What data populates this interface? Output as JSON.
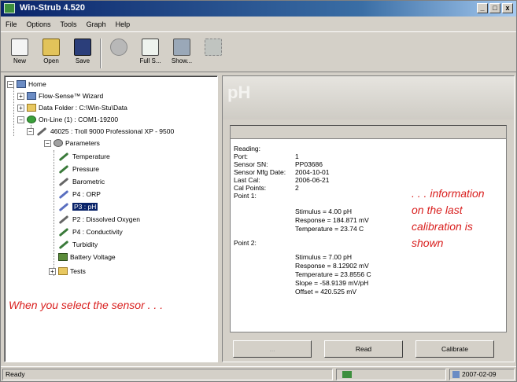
{
  "window": {
    "title": "Win-Strub 4.520",
    "minimize": "_",
    "maximize": "□",
    "close": "x"
  },
  "menu": [
    "File",
    "Options",
    "Tools",
    "Graph",
    "Help"
  ],
  "toolbar": {
    "new": "New",
    "open": "Open",
    "save": "Save",
    "disabled": "",
    "fullscreen": "Full S...",
    "show": "Show..."
  },
  "tree": {
    "home": "Home",
    "wizard": "Flow-Sense™ Wizard",
    "data_folder": "Data Folder : C:\\Win-Stu\\Data",
    "online": "On-Line (1) : COM1-19200",
    "device": "46025 : Troll 9000 Professional XP - 9500",
    "parameters": "Parameters",
    "items": [
      "Temperature",
      "Pressure",
      "Barometric",
      "P4 : ORP",
      "P3 : pH",
      "P2 : Dissolved Oxygen",
      "P4 : Conductivity",
      "Turbidity",
      "Battery Voltage"
    ],
    "tests": "Tests"
  },
  "annotations": {
    "left": "When you select the sensor . . .",
    "right_line1": ". . . information",
    "right_line2": "on the last",
    "right_line3": "calibration is",
    "right_line4": "shown"
  },
  "detail": {
    "header": "pH",
    "reading": "Reading:",
    "fields": [
      {
        "label": "Port:",
        "value": "1"
      },
      {
        "label": "Sensor SN:",
        "value": "PP03686"
      },
      {
        "label": "Sensor Mfg Date:",
        "value": "2004-10-01"
      },
      {
        "label": "Last Cal:",
        "value": "2006-06-21"
      },
      {
        "label": "Cal Points:",
        "value": "2"
      }
    ],
    "point1_label": "Point 1:",
    "point1": [
      "Stimulus = 4.00 pH",
      "Response = 184.871 mV",
      "Temperature = 23.74 C"
    ],
    "point2_label": "Point 2:",
    "point2": [
      "Stimulus = 7.00 pH",
      "Response = 8.12902 mV",
      "Temperature = 23.8556 C",
      "Slope = -58.9139 mV/pH",
      "Offset = 420.525 mV"
    ],
    "buttons": {
      "disabled": "...",
      "read": "Read",
      "calibrate": "Calibrate"
    }
  },
  "status": {
    "left": "Ready",
    "date": "2007-02-09"
  },
  "colors": {
    "annotation": "#d9201f",
    "selection": "#0a246a"
  }
}
